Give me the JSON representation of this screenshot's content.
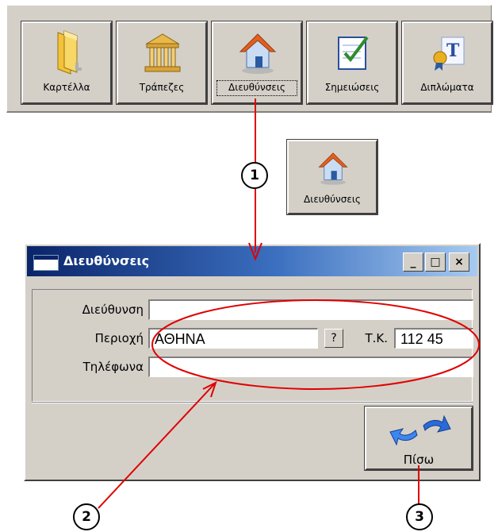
{
  "toolbar": {
    "buttons": [
      {
        "label": "Καρτέλλα",
        "icon": "folder-icon"
      },
      {
        "label": "Τράπεζες",
        "icon": "bank-icon"
      },
      {
        "label": "Διευθύνσεις",
        "icon": "house-icon"
      },
      {
        "label": "Σημειώσεις",
        "icon": "notes-checklist-icon"
      },
      {
        "label": "Διπλώματα",
        "icon": "diploma-icon"
      }
    ]
  },
  "floating_button": {
    "label": "Διευθύνσεις",
    "icon": "house-icon"
  },
  "dialog": {
    "title": "Διευθύνσεις",
    "window_buttons": {
      "minimize": "_",
      "maximize": "□",
      "close": "×"
    },
    "fields": {
      "address_label": "Διεύθυνση",
      "address_value": "",
      "area_label": "Περιοχή",
      "area_value": "ΑΘΗΝΑ",
      "lookup_label": "?",
      "postal_label": "Τ.Κ.",
      "postal_value": "112 45",
      "phones_label": "Τηλέφωνα",
      "phones_value": ""
    },
    "back_button": {
      "label": "Πίσω",
      "icon": "back-arrows-icon"
    }
  },
  "annotations": {
    "markers": [
      "1",
      "2",
      "3"
    ],
    "color": "#e00000"
  },
  "colors": {
    "window_face": "#d4d0c8",
    "titlebar_start": "#0a246a",
    "titlebar_end": "#a6caf0",
    "annotation_red": "#e00000"
  }
}
